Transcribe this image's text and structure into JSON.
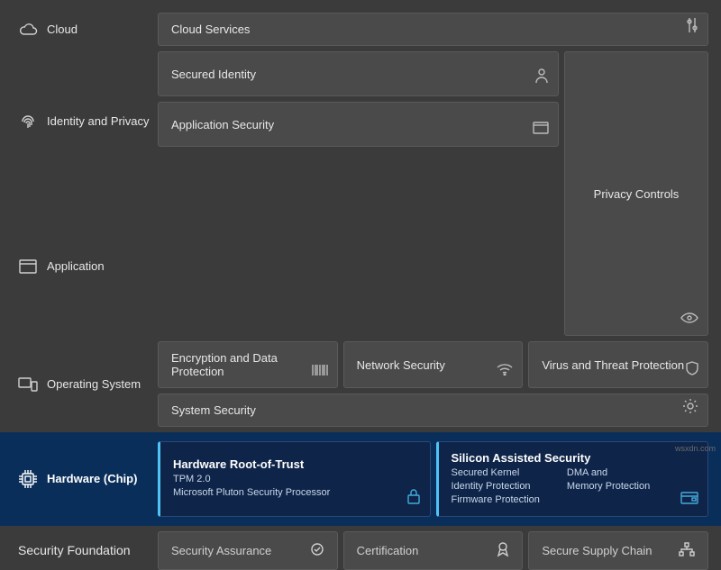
{
  "layers": {
    "cloud": {
      "label": "Cloud",
      "card": "Cloud Services"
    },
    "identity": {
      "label": "Identity and Privacy",
      "card": "Secured Identity",
      "right": "Privacy Controls"
    },
    "application": {
      "label": "Application",
      "card": "Application Security"
    },
    "os": {
      "label": "Operating System",
      "top": {
        "enc": "Encryption and Data Protection",
        "net": "Network Security",
        "virus": "Virus and Threat Protection"
      },
      "bottom": "System Security"
    },
    "hardware": {
      "label": "Hardware (Chip)",
      "left": {
        "title": "Hardware Root-of-Trust",
        "line1": "TPM 2.0",
        "line2": "Microsoft Pluton Security Processor"
      },
      "right": {
        "title": "Silicon Assisted Security",
        "col1_1": "Secured Kernel",
        "col1_2": "Identity Protection",
        "col1_3": "Firmware Protection",
        "col2_1": "DMA and",
        "col2_2": "Memory Protection"
      }
    },
    "security_foundation": {
      "label": "Security Foundation",
      "pill1": "Security Assurance",
      "pill2": "Certification",
      "pill3": "Secure Supply Chain"
    }
  },
  "watermark": "wsxdn.com"
}
